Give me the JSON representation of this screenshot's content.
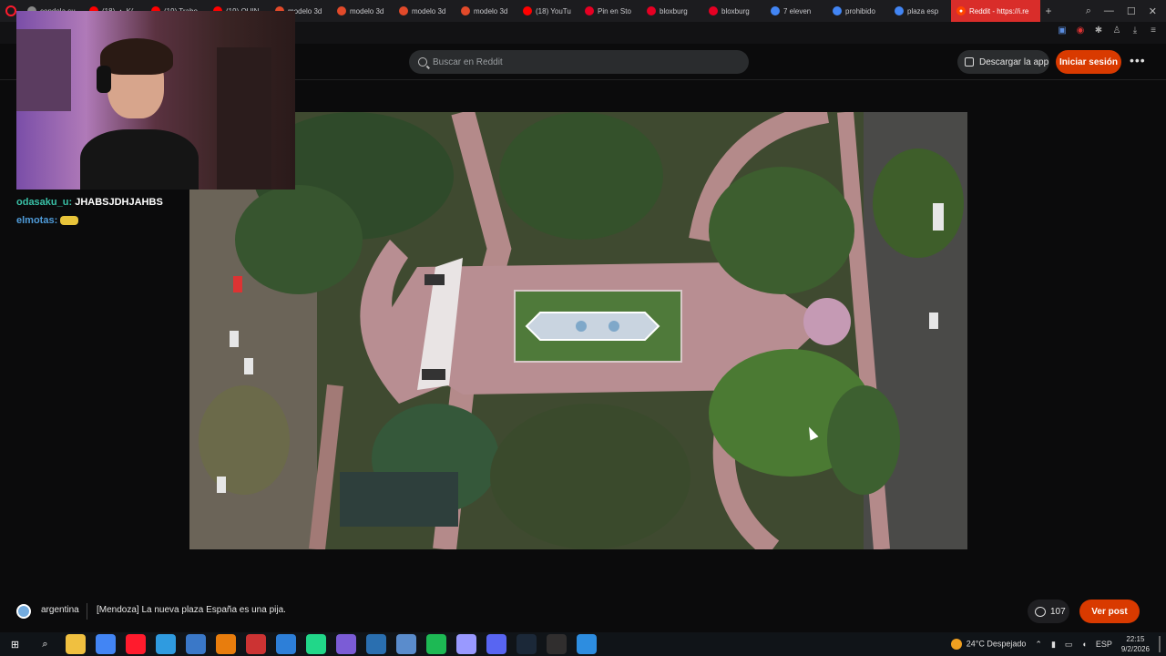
{
  "browser": {
    "tabs": [
      {
        "label": "condela su",
        "icon": "globe-icon",
        "color": "#888888"
      },
      {
        "label": "(18) ▲ K(",
        "icon": "youtube-icon",
        "color": "#ff0000"
      },
      {
        "label": "(19) Trabo",
        "icon": "youtube-icon",
        "color": "#ff0000"
      },
      {
        "label": "(19) QUIN",
        "icon": "youtube-icon",
        "color": "#ff0000"
      },
      {
        "label": "modelo 3d",
        "icon": "cad-icon",
        "color": "#e24a2a"
      },
      {
        "label": "modelo 3d",
        "icon": "cad-icon",
        "color": "#e24a2a"
      },
      {
        "label": "modelo 3d",
        "icon": "cad-icon",
        "color": "#e24a2a"
      },
      {
        "label": "modelo 3d",
        "icon": "cad-icon",
        "color": "#e24a2a"
      },
      {
        "label": "(18) YouTu",
        "icon": "youtube-icon",
        "color": "#ff0000"
      },
      {
        "label": "Pin en Sto",
        "icon": "pinterest-icon",
        "color": "#e60023"
      },
      {
        "label": "bloxburg",
        "icon": "pinterest-icon",
        "color": "#e60023"
      },
      {
        "label": "bloxburg",
        "icon": "pinterest-icon",
        "color": "#e60023"
      },
      {
        "label": "7 eleven",
        "icon": "google-icon",
        "color": "#4285f4"
      },
      {
        "label": "prohibido",
        "icon": "google-icon",
        "color": "#4285f4"
      },
      {
        "label": "plaza esp",
        "icon": "google-icon",
        "color": "#4285f4"
      }
    ],
    "active_tab": {
      "label": "Reddit - https://i.re",
      "icon": "reddit-icon"
    },
    "new_tab_symbol": "+"
  },
  "reddit": {
    "search_placeholder": "Buscar en Reddit",
    "get_app_label": "Descargar la app",
    "login_label": "Iniciar sesión",
    "more_symbol": "•••",
    "accent_color": "#d93a00"
  },
  "stream_chat": {
    "messages": [
      {
        "user": "odasaku_u:",
        "text": "JHABSJDHJAHBS"
      },
      {
        "user": "elmotas:",
        "text": ""
      }
    ]
  },
  "post": {
    "subreddit": "argentina",
    "title": "[Mendoza] La nueva plaza España es una pija.",
    "comment_count": "107",
    "view_post_label": "Ver post"
  },
  "taskbar": {
    "weather": "24°C  Despejado",
    "language": "ESP",
    "time": "22:15",
    "date": "9/2/2026",
    "apps": [
      "windows-start-icon",
      "search-icon",
      "file-explorer-icon",
      "chrome-icon",
      "opera-icon",
      "edge-icon",
      "app-icon",
      "blender-icon",
      "video-editor-icon",
      "photos-icon",
      "pycharm-icon",
      "visual-studio-icon",
      "app-icon",
      "app-icon",
      "spotify-icon",
      "after-effects-icon",
      "discord-icon",
      "steam-icon",
      "obs-icon",
      "app-icon"
    ]
  }
}
